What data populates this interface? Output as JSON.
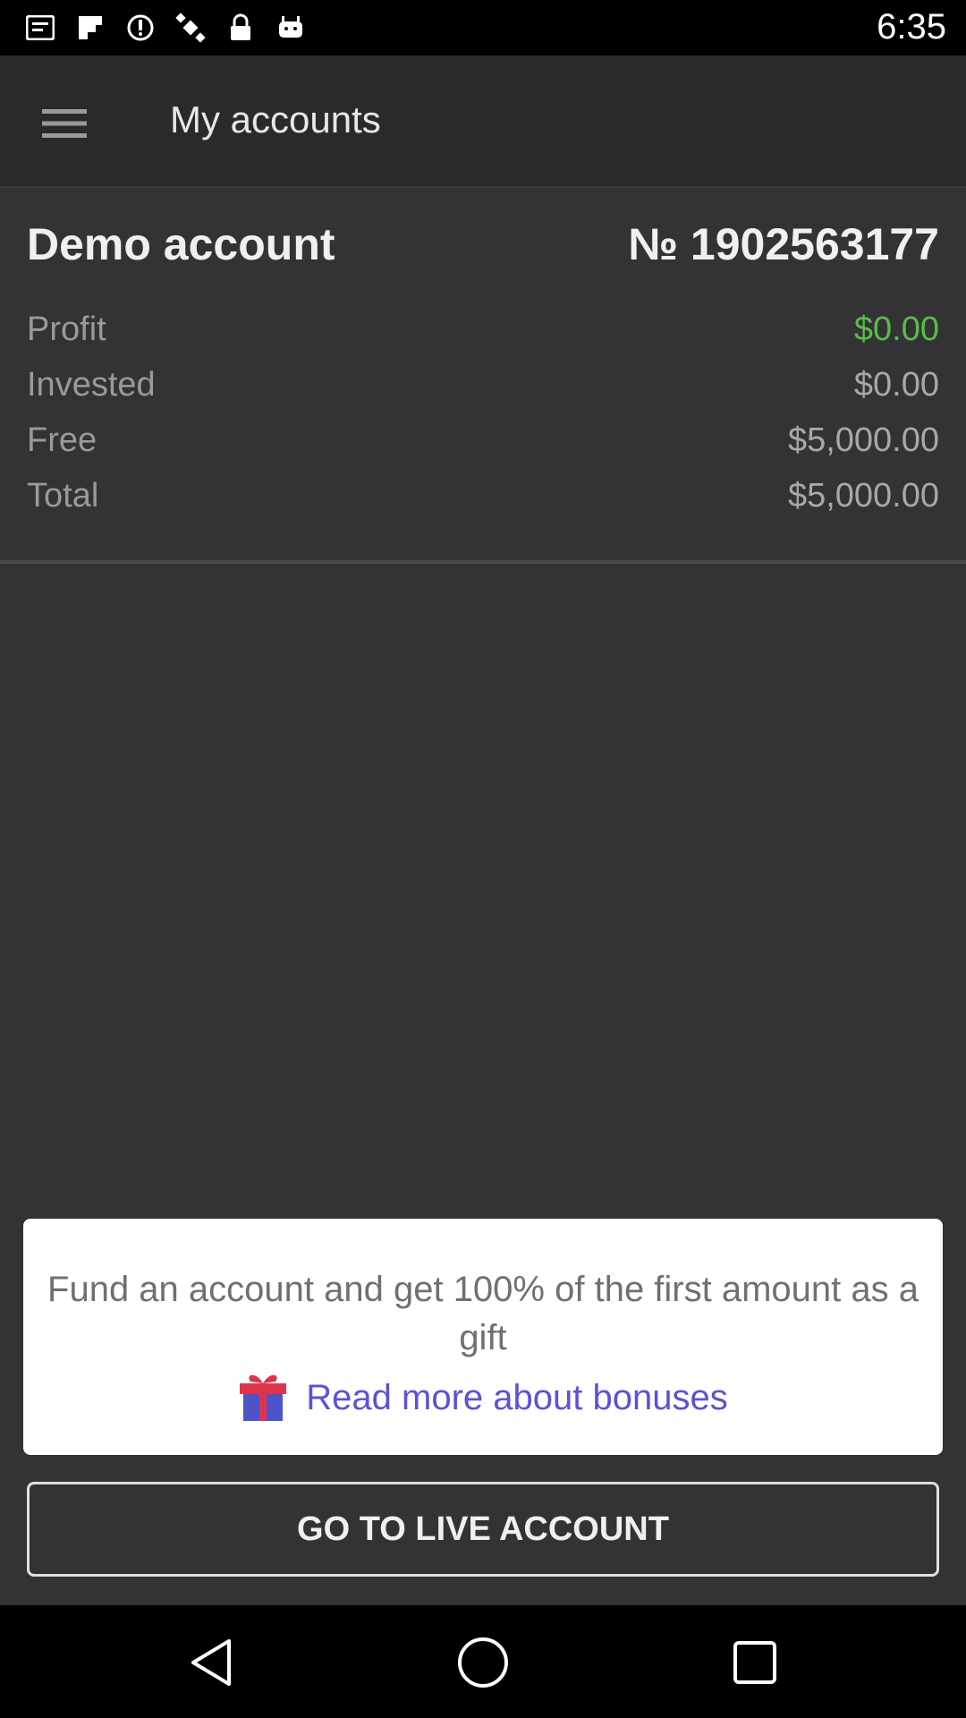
{
  "status_bar": {
    "time": "6:35",
    "icons": [
      "notification-icon",
      "flipboard-icon",
      "sync-icon",
      "satellite-icon",
      "lock-icon",
      "android-icon"
    ]
  },
  "app_bar": {
    "title": "My accounts",
    "menu_icon": "hamburger-menu-icon"
  },
  "account": {
    "name": "Demo account",
    "number": "№ 1902563177",
    "rows": [
      {
        "label": "Profit",
        "value": "$0.00",
        "color": "#5dbb4b"
      },
      {
        "label": "Invested",
        "value": "$0.00"
      },
      {
        "label": "Free",
        "value": "$5,000.00"
      },
      {
        "label": "Total",
        "value": "$5,000.00"
      }
    ]
  },
  "promo": {
    "text": "Fund an account and get 100% of the first amount as a gift",
    "link_label": "Read more about bonuses",
    "link_icon": "gift-icon",
    "link_color": "#5b52d6"
  },
  "live_button": {
    "label": "GO TO LIVE ACCOUNT"
  },
  "nav_bar": {
    "icons": [
      "back-icon",
      "home-icon",
      "recents-icon"
    ]
  }
}
